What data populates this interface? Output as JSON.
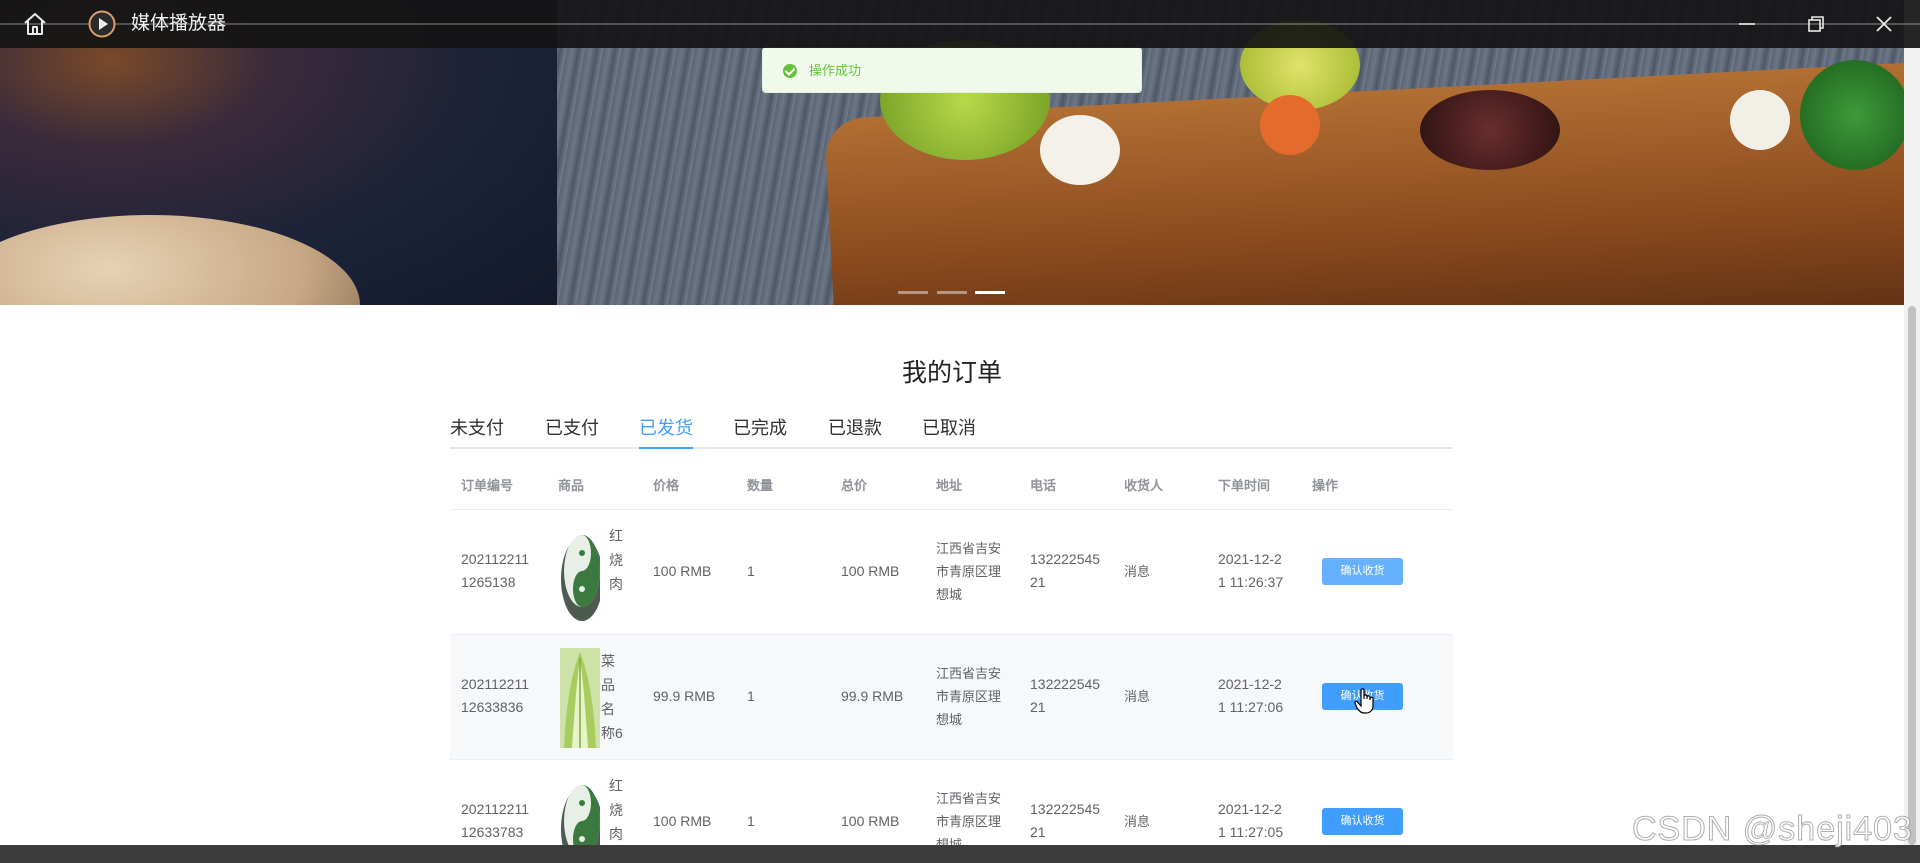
{
  "titlebar": {
    "app_title": "媒体播放器"
  },
  "toast": {
    "message": "操作成功",
    "color": "#67c23a"
  },
  "page": {
    "title": "我的订单",
    "accent": "#409eff"
  },
  "tabs": [
    {
      "label": "未支付",
      "active": false
    },
    {
      "label": "已支付",
      "active": false
    },
    {
      "label": "已发货",
      "active": true
    },
    {
      "label": "已完成",
      "active": false
    },
    {
      "label": "已退款",
      "active": false
    },
    {
      "label": "已取消",
      "active": false
    }
  ],
  "table": {
    "headers": [
      "订单编号",
      "商品",
      "价格",
      "数量",
      "总价",
      "地址",
      "电话",
      "收货人",
      "下单时间",
      "操作"
    ],
    "rows": [
      {
        "order_no": [
          "202112211",
          "1265138"
        ],
        "product_name": [
          "红",
          "烧",
          "肉"
        ],
        "product_icon": "yin-yang-dish-image",
        "price": "100 RMB",
        "qty": "1",
        "total": "100 RMB",
        "address": [
          "江西省吉安",
          "市青原区理",
          "想城"
        ],
        "phone": [
          "132222545",
          "21"
        ],
        "receiver": "消息",
        "time": [
          "2021-12-2",
          "1 11:26:37"
        ],
        "action": "确认收货"
      },
      {
        "order_no": [
          "202112211",
          "12633836"
        ],
        "product_name": [
          "菜",
          "品",
          "名",
          "称6"
        ],
        "product_icon": "cabbage-image",
        "price": "99.9 RMB",
        "qty": "1",
        "total": "99.9 RMB",
        "address": [
          "江西省吉安",
          "市青原区理",
          "想城"
        ],
        "phone": [
          "132222545",
          "21"
        ],
        "receiver": "消息",
        "time": [
          "2021-12-2",
          "1 11:27:06"
        ],
        "action": "确认收货"
      },
      {
        "order_no": [
          "202112211",
          "12633783"
        ],
        "product_name": [
          "红",
          "烧",
          "肉"
        ],
        "product_icon": "yin-yang-dish-image",
        "price": "100 RMB",
        "qty": "1",
        "total": "100 RMB",
        "address": [
          "江西省吉安",
          "市青原区理",
          "想城"
        ],
        "phone": [
          "132222545",
          "21"
        ],
        "receiver": "消息",
        "time": [
          "2021-12-2",
          "1 11:27:05"
        ],
        "action": "确认收货"
      }
    ]
  },
  "watermark": "CSDN @sheji403"
}
